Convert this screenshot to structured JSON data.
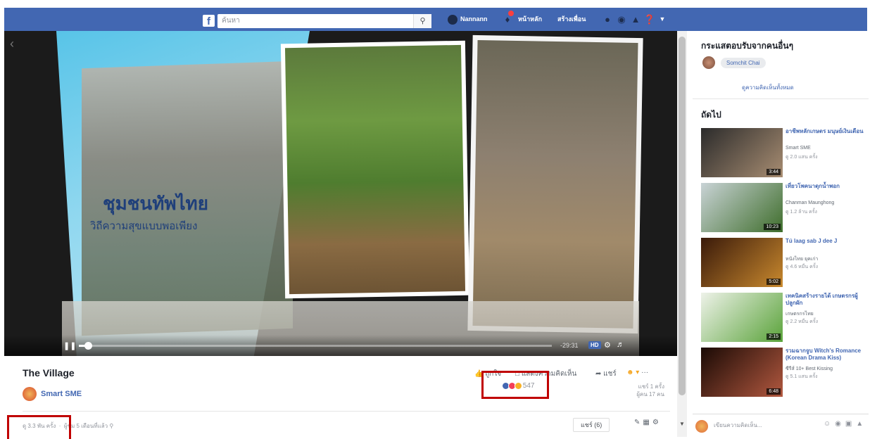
{
  "topbar": {
    "logo": "f",
    "search_placeholder": "ค้นหา",
    "search_icon": "search-icon",
    "profile_name": "Nannann",
    "home": "หน้าหลัก",
    "create": "สร้างเพื่อน"
  },
  "player": {
    "overlay_title": "ชุมชนทัพไทย",
    "overlay_subtitle": "วิถีความสุขแบบพอเพียง",
    "progress": 0.02,
    "time": "-29:31",
    "hd_label": "HD"
  },
  "video": {
    "title": "The Village",
    "page_name": "Smart SME",
    "actions": {
      "like": "ถูกใจ",
      "comment": "แสดงความคิดเห็น",
      "share": "แชร์"
    },
    "reaction_count": "547",
    "shares_text_1": "แชร์ 1 ครั้ง",
    "shares_text_2": "ผู้คน 17 คน",
    "views": "ดู 3.3 พัน ครั้ง",
    "views_extra": "ผู้ชม 5 เดือนที่แล้ว",
    "sort_label": "แชร์ (6)"
  },
  "sidebar": {
    "recommend_heading": "กระแสตอบรับจากคนอื่นๆ",
    "recommend_user": "Somchit Chai",
    "see_all": "ดูความคิดเห็นทั้งหมด",
    "next_heading": "ถัดไป",
    "items": [
      {
        "title": "อาชีพหลักเกษตร มนุษย์เงินเดือน",
        "channel": "Smart SME",
        "views": "ดู 2.0 แสน ครั้ง",
        "duration": "3:44",
        "color1": "#2b2b2b",
        "color2": "#a88d72"
      },
      {
        "title": "เที่ยวโพคนาดุกน้ำพอก",
        "channel": "Chanman Maunghong",
        "views": "ดู 1.2 ล้าน ครั้ง",
        "duration": "10:23",
        "color1": "#c9d3d6",
        "color2": "#3f6e2c"
      },
      {
        "title": "Tú laag sab J dee J",
        "channel": "หนังไทย ยุคเก่า",
        "views": "ดู 4.6 หมื่น ครั้ง",
        "duration": "5:02",
        "color1": "#3a1a0a",
        "color2": "#c9892e"
      },
      {
        "title": "เทคนิคสร้างรายได้ เกษตรกรผู้ปลูกผัก",
        "channel": "เกษตรกรไทย",
        "views": "ดู 2.2 หมื่น ครั้ง",
        "duration": "2:15",
        "color1": "#eef2e9",
        "color2": "#5aa33a"
      },
      {
        "title": "รวมฉากจูบ Witch's Romance (Korean Drama Kiss)",
        "channel": "ซีรีส์ 10+ Best Kissing",
        "views": "ดู 5.1 แสน ครั้ง",
        "duration": "6:48",
        "color1": "#1a0a05",
        "color2": "#b2583f"
      }
    ]
  },
  "chat": {
    "placeholder": "เขียนความคิดเห็น..."
  },
  "colors": {
    "brand": "#4267b2",
    "highlight": "#c00000"
  }
}
